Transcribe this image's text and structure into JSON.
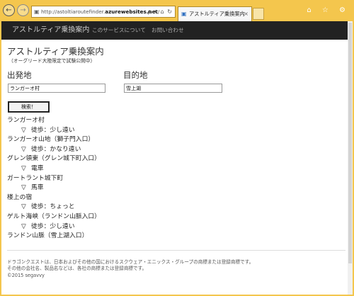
{
  "browser": {
    "url_prefix": "http://astoltiaroutefinder.",
    "url_domain": "azurewebsites.net",
    "url_suffix": "/",
    "address_tools": "ρ ▾ ⌂ ↻",
    "tab_title": "アストルティア乗換案内",
    "tab_close": "×",
    "window_icons": "⌂ ☆ ⚙"
  },
  "site_nav": {
    "brand": "アストルティア乗換案内",
    "services": "このサービスについて",
    "contact": "お問い合わせ"
  },
  "main": {
    "title": "アストルティア乗換案内",
    "subtitle": "（オーグリード大陸限定で試験公開中）",
    "from_label": "出発地",
    "to_label": "目的地",
    "from_value": "ランガーオ村",
    "to_value": "雪上湖",
    "search_button": "検索！"
  },
  "route": [
    {
      "kind": "place",
      "text": "ランガーオ村"
    },
    {
      "kind": "move",
      "arrow": "▽",
      "text": "徒歩：少し遠い"
    },
    {
      "kind": "place",
      "text": "ランガーオ山地（獅子門入口）"
    },
    {
      "kind": "move",
      "arrow": "▽",
      "text": "徒歩：かなり遠い"
    },
    {
      "kind": "place",
      "text": "グレン領東（グレン城下町入口）"
    },
    {
      "kind": "move",
      "arrow": "▽",
      "text": "電車"
    },
    {
      "kind": "place",
      "text": "ガートラント城下町"
    },
    {
      "kind": "move",
      "arrow": "▽",
      "text": "馬車"
    },
    {
      "kind": "place",
      "text": "楼上の宿"
    },
    {
      "kind": "move",
      "arrow": "▽",
      "text": "徒歩：ちょっと"
    },
    {
      "kind": "place",
      "text": "ゲルト海峡（ランドン山脈入口）"
    },
    {
      "kind": "move",
      "arrow": "▽",
      "text": "徒歩：少し遠い"
    },
    {
      "kind": "place",
      "text": "ランドン山脈（雪上湖入口）"
    }
  ],
  "footer": {
    "line1": "ドラゴンクエストは、日本およびその他の国におけるスクウェア・エニックス・グループの商標または登録商標です。",
    "line2": "その他の会社名、製品名などは、各社の商標または登録商標です。",
    "line3": "©2015 segavvy"
  },
  "colors": {
    "browser_frame": "#f4c64d",
    "navbar": "#222222"
  }
}
